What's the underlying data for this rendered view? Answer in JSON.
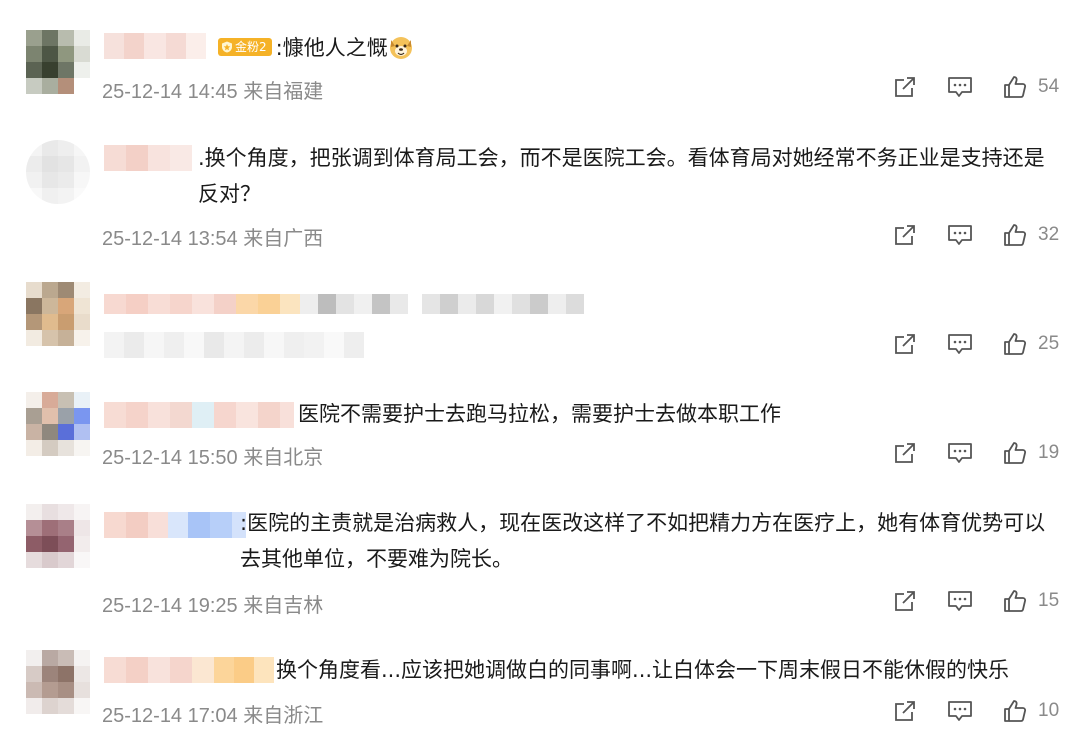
{
  "comments": [
    {
      "text": ":慷他人之慨",
      "badge": "金粉2",
      "emoji": "dog-face-emoji",
      "time": "25-12-14 14:45",
      "location": "来自福建",
      "likes": "54"
    },
    {
      "text": ".换个角度，把张调到体育局工会，而不是医院工会。看体育局对她经常不务正业是支持还是反对？",
      "time": "25-12-14 13:54",
      "location": "来自广西",
      "likes": "32"
    },
    {
      "text": "",
      "time": "",
      "location": "",
      "likes": "25"
    },
    {
      "text": "医院不需要护士去跑马拉松，需要护士去做本职工作",
      "time": "25-12-14 15:50",
      "location": "来自北京",
      "likes": "19"
    },
    {
      "text": ":医院的主责就是治病救人，现在医改这样了不如把精力方在医疗上，她有体育优势可以去其他单位，不要难为院长。",
      "time": "25-12-14 19:25",
      "location": "来自吉林",
      "likes": "15"
    },
    {
      "text": "换个角度看...应该把她调做白的同事啊...让白体会一下周末假日不能休假的快乐",
      "time": "25-12-14 17:04",
      "location": "来自浙江",
      "likes": "10"
    }
  ],
  "icons": {
    "share": "share-icon",
    "reply": "comment-icon",
    "like": "thumbs-up-icon"
  },
  "colors": {
    "text": "#1a1a1a",
    "meta": "#8a8a8a",
    "badge": "#f5b227"
  }
}
